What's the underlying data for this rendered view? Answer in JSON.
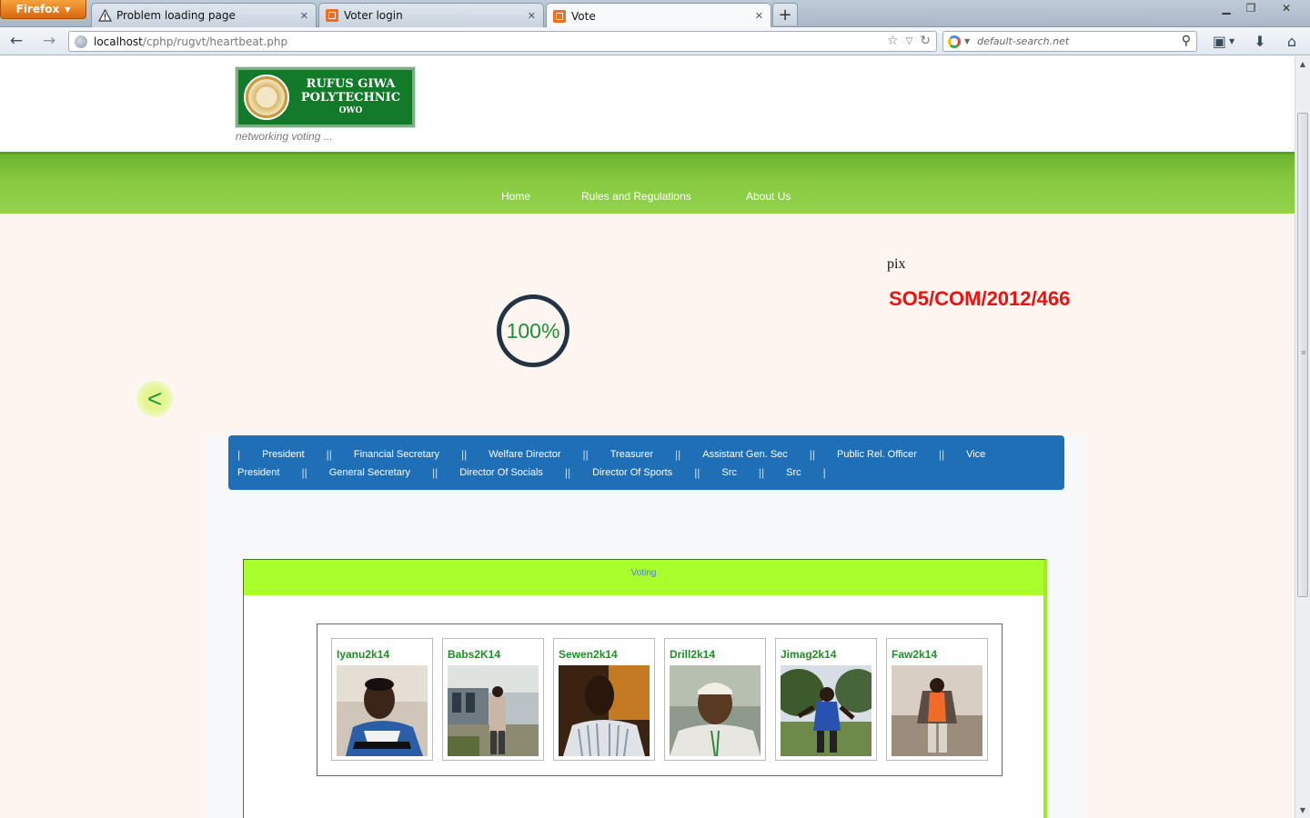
{
  "browser": {
    "menu_button": "Firefox",
    "tabs": [
      {
        "title": "Problem loading page",
        "icon": "warning-icon"
      },
      {
        "title": "Voter login",
        "icon": "xampp-icon"
      },
      {
        "title": "Vote",
        "icon": "xampp-icon",
        "active": true
      }
    ],
    "url_host": "localhost",
    "url_path": "/cphp/rugvt/heartbeat.php",
    "search_placeholder": "default-search.net"
  },
  "header": {
    "logo_line1": "RUFUS GIWA",
    "logo_line2": "POLYTECHNIC",
    "logo_line3": "OWO",
    "tagline": "networking voting ..."
  },
  "nav": {
    "items": [
      {
        "label": "Home"
      },
      {
        "label": "Rules and Regulations"
      },
      {
        "label": "About Us"
      }
    ]
  },
  "user": {
    "pix_label": "pix",
    "reg_number": "SO5/COM/2012/466"
  },
  "progress": {
    "value_text": "100%",
    "value": 100
  },
  "back_button": {
    "label": "<"
  },
  "positions": [
    "President",
    "Financial Secretary",
    "Welfare Director",
    "Treasurer",
    "Assistant Gen. Sec",
    "Public Rel. Officer",
    "Vice President",
    "General Secretary",
    "Director Of Socials",
    "Director Of Sports",
    "Src",
    "Src"
  ],
  "positions_row1": [
    "President",
    "Financial Secretary",
    "Welfare Director",
    "Treasurer",
    "Assistant Gen. Sec",
    "Public Rel. Officer",
    "Vice"
  ],
  "positions_row2": [
    "President",
    "General Secretary",
    "Director Of Socials",
    "Director Of Sports",
    "Src",
    "Src"
  ],
  "voting": {
    "title": "Voting",
    "candidates": [
      {
        "name": "Iyanu2k14"
      },
      {
        "name": "Babs2K14"
      },
      {
        "name": "Sewen2k14"
      },
      {
        "name": "Drill2k14"
      },
      {
        "name": "Jimag2k14"
      },
      {
        "name": "Faw2k14"
      }
    ]
  },
  "colors": {
    "nav_green": "#86c940",
    "positions_blue": "#1f6fb7",
    "voting_header": "#a9ff2c",
    "reg_red": "#ee1111",
    "candidate_name_green": "#1d8f27"
  }
}
